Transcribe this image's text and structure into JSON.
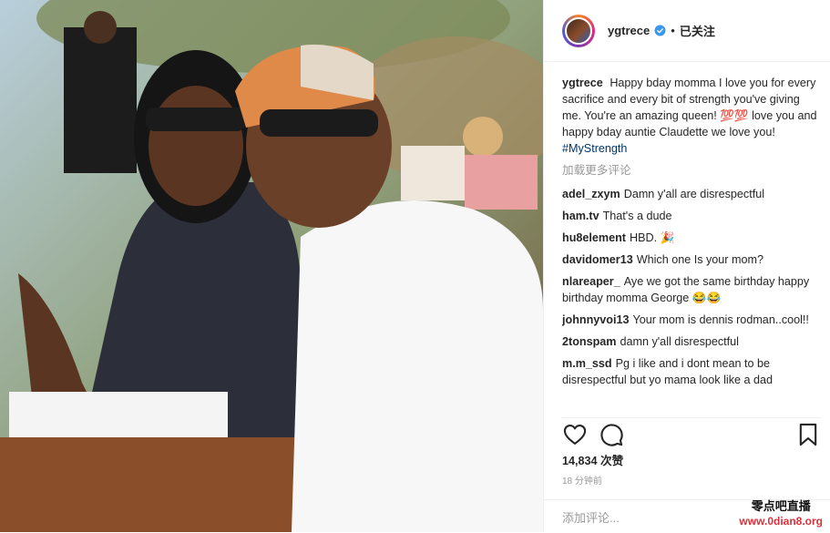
{
  "header": {
    "username": "ygtrece",
    "separator": "•",
    "follow_state": "已关注"
  },
  "caption": {
    "username": "ygtrece",
    "text": "Happy bday momma I love you for every sacrifice and every bit of strength you've giving me. You're an amazing queen! 💯💯 love you and happy bday auntie Claudette we love you!",
    "hashtag": "#MyStrength"
  },
  "load_more": "加载更多评论",
  "comments": [
    {
      "user": "adel_zxym",
      "text": "Damn y'all are disrespectful"
    },
    {
      "user": "ham.tv",
      "text": "That's a dude"
    },
    {
      "user": "hu8element",
      "text": "HBD. 🎉"
    },
    {
      "user": "davidomer13",
      "text": "Which one Is your mom?"
    },
    {
      "user": "nlareaper_",
      "text": "Aye we got the same birthday happy birthday momma George 😂😂"
    },
    {
      "user": "johnnyvoi13",
      "text": "Your mom is dennis rodman..cool!!"
    },
    {
      "user": "2tonspam",
      "text": "damn y'all disrespectful"
    },
    {
      "user": "m.m_ssd",
      "text": "Pg i like and i dont mean to be disrespectful but yo mama look like a dad"
    }
  ],
  "icons": {
    "like": "heart-icon",
    "comment": "comment-icon",
    "save": "bookmark-icon",
    "verified": "verified-badge-icon"
  },
  "likes": "14,834 次赞",
  "timestamp": "18 分钟前",
  "add_comment_placeholder": "添加评论...",
  "watermark": {
    "line1": "零点吧直播",
    "line2": "www.0dian8.org"
  },
  "colors": {
    "accent_blue": "#3897f0",
    "hashtag": "#003569",
    "muted": "#999999",
    "watermark_red": "#d8323c"
  }
}
